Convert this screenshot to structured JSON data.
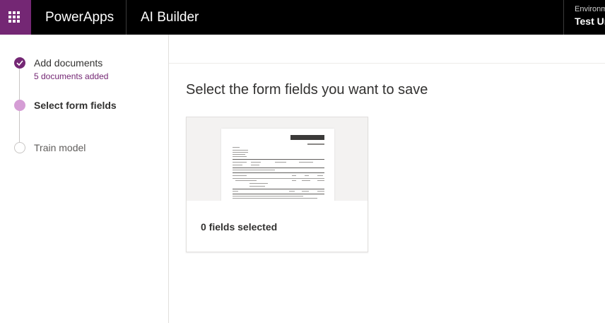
{
  "topbar": {
    "brand": "PowerApps",
    "app_title": "AI Builder",
    "environment_label": "Environm",
    "environment_name": "Test Ur"
  },
  "steps": [
    {
      "title": "Add documents",
      "subtitle": "5 documents added",
      "state": "done"
    },
    {
      "title": "Select form fields",
      "state": "current"
    },
    {
      "title": "Train model",
      "state": "todo"
    }
  ],
  "main": {
    "title": "Select the form fields you want to save",
    "card": {
      "caption": "0 fields selected"
    }
  },
  "colors": {
    "accent": "#742774",
    "accent_light": "#d59dd5",
    "topbar_bg": "#000000"
  }
}
